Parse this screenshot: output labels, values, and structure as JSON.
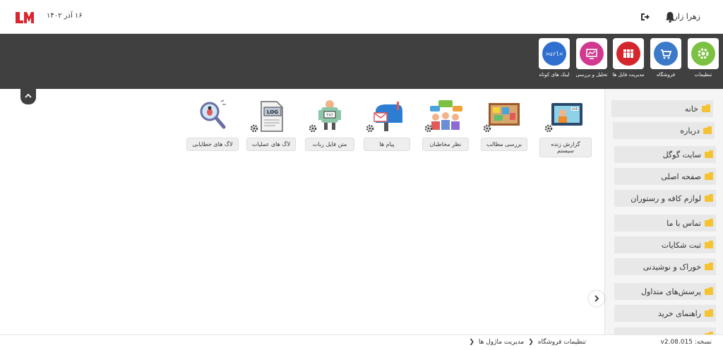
{
  "header": {
    "logo_text": "LM",
    "date": "۱۶ آذر ۱۴۰۲",
    "username": "زهرا زارع",
    "icons": [
      "logout-icon",
      "bell-icon"
    ]
  },
  "toolbar": {
    "items": [
      {
        "label": "تنظیمات",
        "icon": "settings-icon",
        "color": "#7cc142"
      },
      {
        "label": "فروشگاه",
        "icon": "cart-icon",
        "color": "#3b7ac9"
      },
      {
        "label": "مدیریت فایل ها",
        "icon": "file-manager-icon",
        "color": "#d3262d"
      },
      {
        "label": "تحلیل و بررسی",
        "icon": "analytics-icon",
        "color": "#d1388f"
      },
      {
        "label": "لینک های کوتاه",
        "icon": "short-link-icon",
        "color": "#2f6fcf"
      }
    ]
  },
  "modules": [
    {
      "label": "گزارش زنده سیستم",
      "icon": "live-report-icon"
    },
    {
      "label": "بررسی مطالب",
      "icon": "content-review-icon"
    },
    {
      "label": "نظر مخاطبان",
      "icon": "audience-comments-icon"
    },
    {
      "label": "پیام ها",
      "icon": "mailbox-icon"
    },
    {
      "label": "متن فایل ربات",
      "icon": "robot-txt-icon"
    },
    {
      "label": "لاگ های عملیات",
      "icon": "operation-log-icon"
    },
    {
      "label": "لاگ های خطایابی",
      "icon": "bug-search-icon"
    }
  ],
  "sidebar": {
    "items": [
      {
        "label": "خانه"
      },
      {
        "label": "درباره"
      },
      {
        "label": "سایت گوگل"
      },
      {
        "label": "صفحه اصلی"
      },
      {
        "label": "لوازم کافه و رستوران"
      },
      {
        "label": "تماس با ما"
      },
      {
        "label": "ثبت شکایات"
      },
      {
        "label": "خوراک و نوشیدنی"
      },
      {
        "label": "پرسش‌های متداول"
      },
      {
        "label": "راهنمای خرید"
      }
    ]
  },
  "footer": {
    "version": "نسخه: v2.08.015",
    "breadcrumbs": [
      "تنظیمات فروشگاه",
      "مدیریت ماژول ها"
    ]
  },
  "colors": {
    "toolbar_bg": "#404040",
    "brand": "#d9262e",
    "folder": "#f5c232"
  }
}
